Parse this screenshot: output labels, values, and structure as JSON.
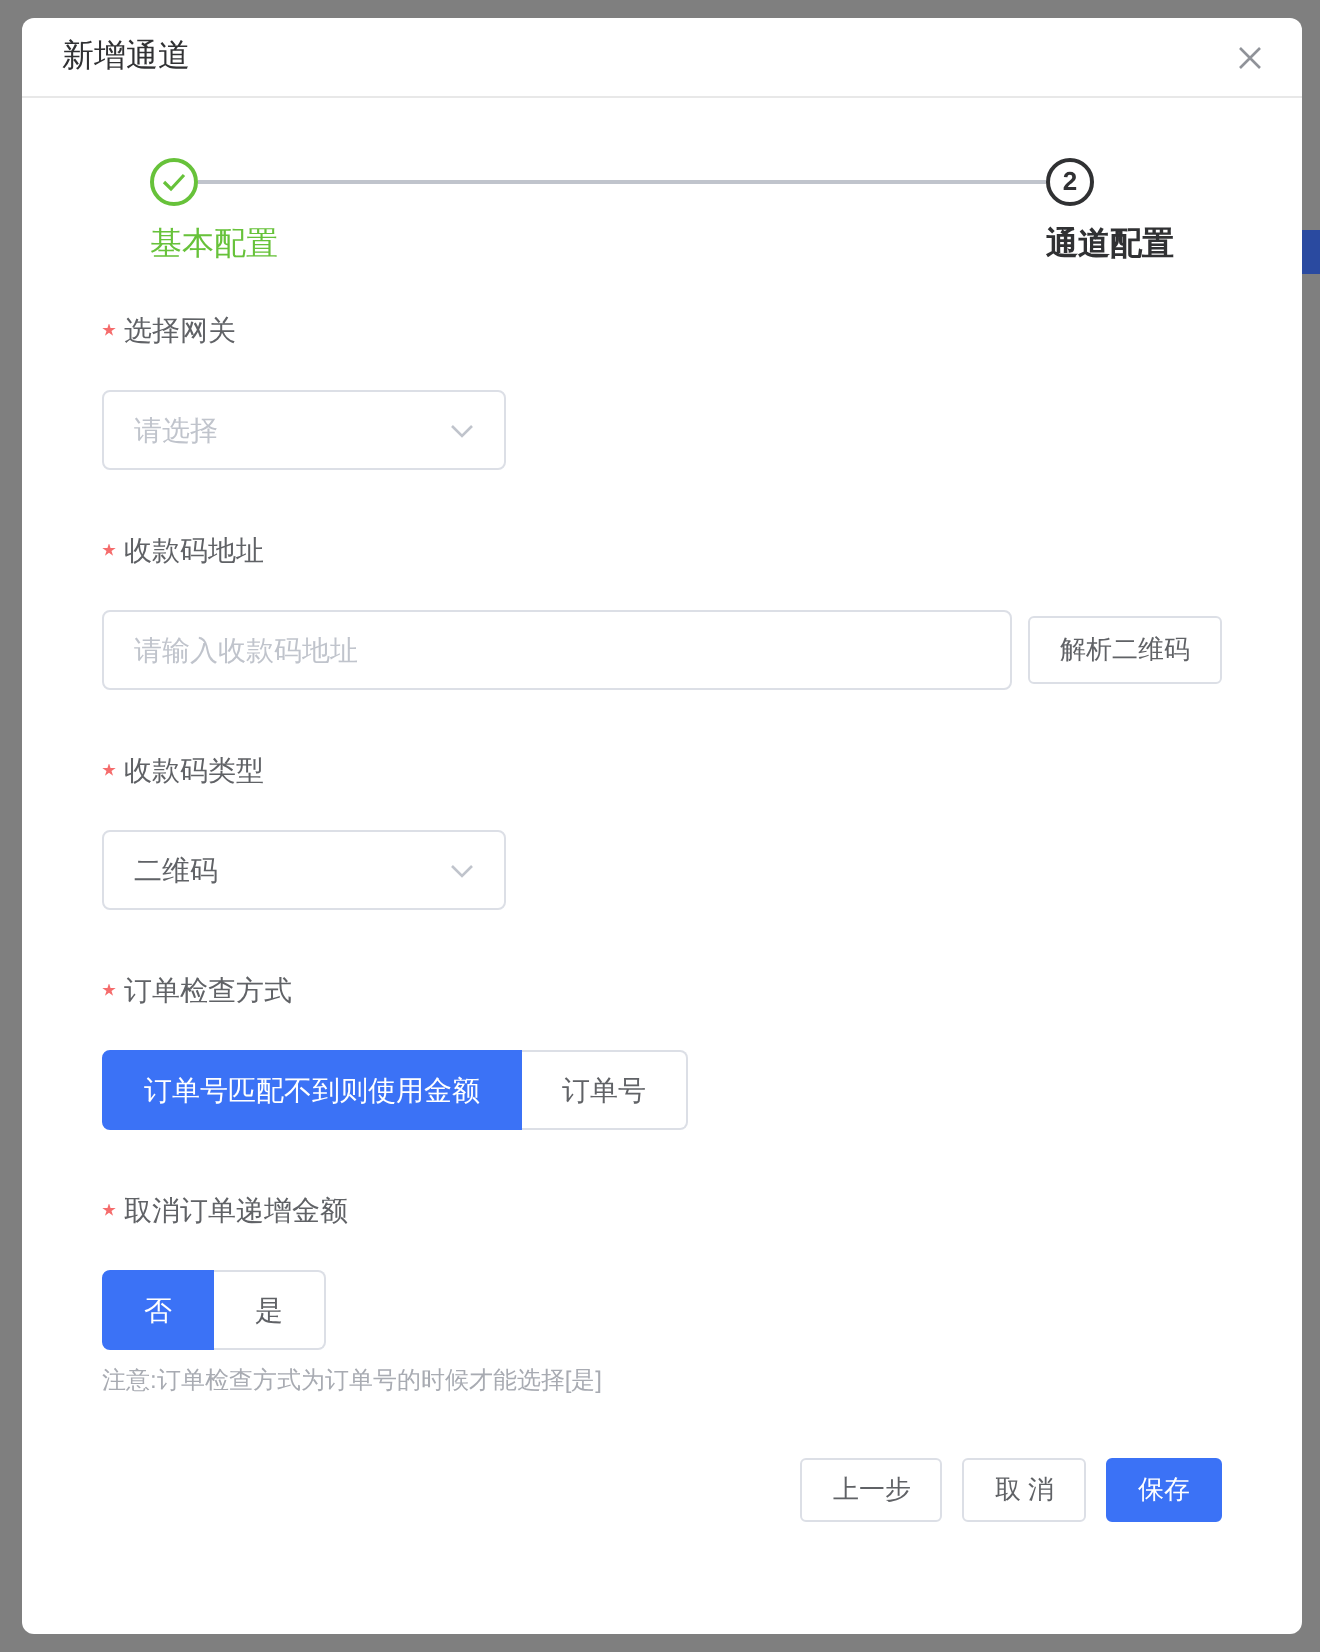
{
  "dialog": {
    "title": "新增通道"
  },
  "steps": [
    {
      "label": "基本配置",
      "completed": true
    },
    {
      "label": "通道配置",
      "completed": false,
      "number": "2"
    }
  ],
  "fields": [
    {
      "kind": "select",
      "label": "选择网关",
      "required": true,
      "placeholder": "请选择"
    },
    {
      "kind": "input",
      "label": "收款码地址",
      "required": true,
      "placeholder": "请输入收款码地址",
      "button": "解析二维码"
    },
    {
      "kind": "select",
      "label": "收款码类型",
      "required": true,
      "value": "二维码"
    },
    {
      "kind": "segmented",
      "label": "订单检查方式",
      "required": true,
      "options": [
        {
          "label": "订单号匹配不到则使用金额",
          "selected": true
        },
        {
          "label": "订单号",
          "selected": false
        }
      ]
    },
    {
      "kind": "segmented",
      "label": "取消订单递增金额",
      "required": true,
      "options": [
        {
          "label": "否",
          "selected": true
        },
        {
          "label": "是",
          "selected": false
        }
      ],
      "note": "注意:订单检查方式为订单号的时候才能选择[是]"
    }
  ],
  "buttons": [
    {
      "label": "上一步",
      "kind": "default"
    },
    {
      "label": "取 消",
      "kind": "default"
    },
    {
      "label": "保存",
      "kind": "primary"
    }
  ]
}
